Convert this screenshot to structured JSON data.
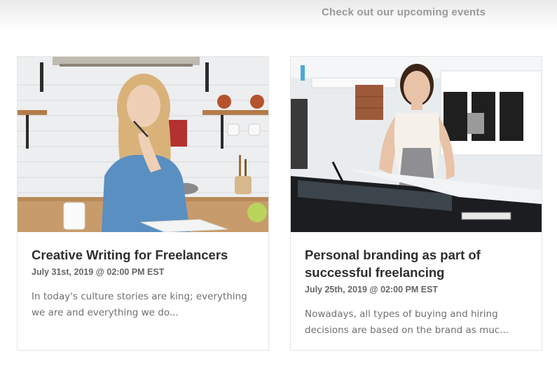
{
  "header": {
    "subtitle": "Check out our upcoming events"
  },
  "events": [
    {
      "title": "Creative Writing for Freelancers",
      "date": "July 31st, 2019 @ 02:00 PM EST",
      "excerpt": "In today's culture stories are king; everything we are and everything we do..."
    },
    {
      "title": "Personal branding as part of successful freelancing",
      "date": "July 25th, 2019 @ 02:00 PM EST",
      "excerpt": "Nowadays, all types of buying and hiring decisions are based on the brand as muc..."
    }
  ]
}
